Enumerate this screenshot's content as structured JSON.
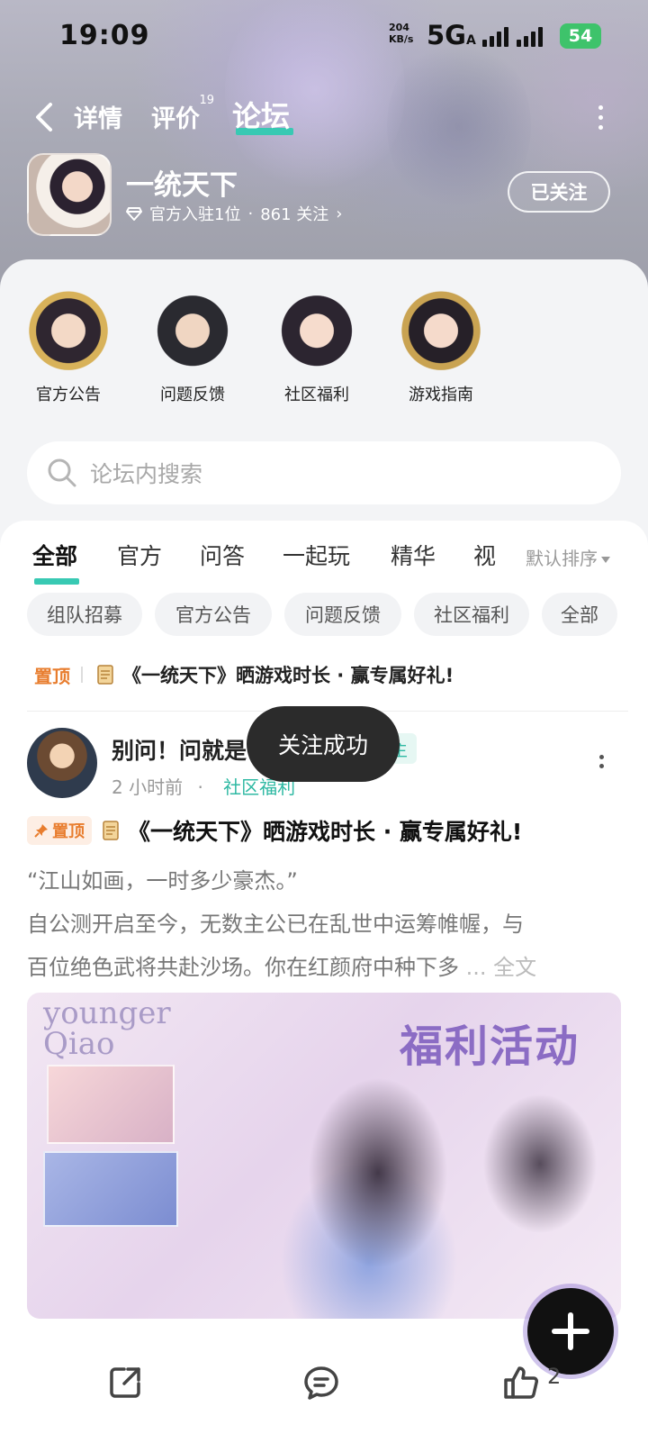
{
  "status_bar": {
    "time": "19:09",
    "net_speed_value": "204",
    "net_speed_unit": "KB/s",
    "network": "5G",
    "network_suffix": "A",
    "battery": "54"
  },
  "nav": {
    "tabs": [
      {
        "label": "详情"
      },
      {
        "label": "评价",
        "badge": "19"
      },
      {
        "label": "论坛"
      }
    ],
    "active_index": 2
  },
  "game": {
    "title": "一统天下",
    "meta_rank": "官方入驻1位",
    "meta_dot": "·",
    "meta_follow": "861 关注",
    "meta_chevron": "›",
    "follow_label": "已关注"
  },
  "shortcuts": [
    {
      "label": "官方公告"
    },
    {
      "label": "问题反馈"
    },
    {
      "label": "社区福利"
    },
    {
      "label": "游戏指南"
    }
  ],
  "search": {
    "placeholder": "论坛内搜索"
  },
  "category_tabs": [
    "全部",
    "官方",
    "问答",
    "一起玩",
    "精华",
    "视"
  ],
  "sort_label": "默认排序",
  "chips": [
    "组队招募",
    "官方公告",
    "问题反馈",
    "社区福利",
    "全部"
  ],
  "pinned": {
    "tag": "置顶",
    "title": "《一统天下》晒游戏时长 · 赢专属好礼!"
  },
  "post": {
    "author": "别问！问就是",
    "badge": "方版主",
    "time": "2 小时前",
    "dot": "·",
    "category": "社区福利",
    "pin_label": "置顶",
    "title": "《一统天下》晒游戏时长 · 赢专属好礼!",
    "body_line1": "“江山如画，一时多少豪杰。”",
    "body_line2": "自公测开启至今，无数主公已在乱世中运筹帷幄，与",
    "body_line3": "百位绝色武将共赴沙场。你在红颜府中种下多",
    "body_more": "... 全文",
    "image_text_top": "younger",
    "image_text_bottom": "Qiao",
    "image_title": "福利活动"
  },
  "toast": "关注成功",
  "bottom_bar": {
    "like_count": "2"
  },
  "colors": {
    "accent": "#38c9b3",
    "pin": "#e87d2e",
    "toast_bg": "#2b2b2b"
  }
}
